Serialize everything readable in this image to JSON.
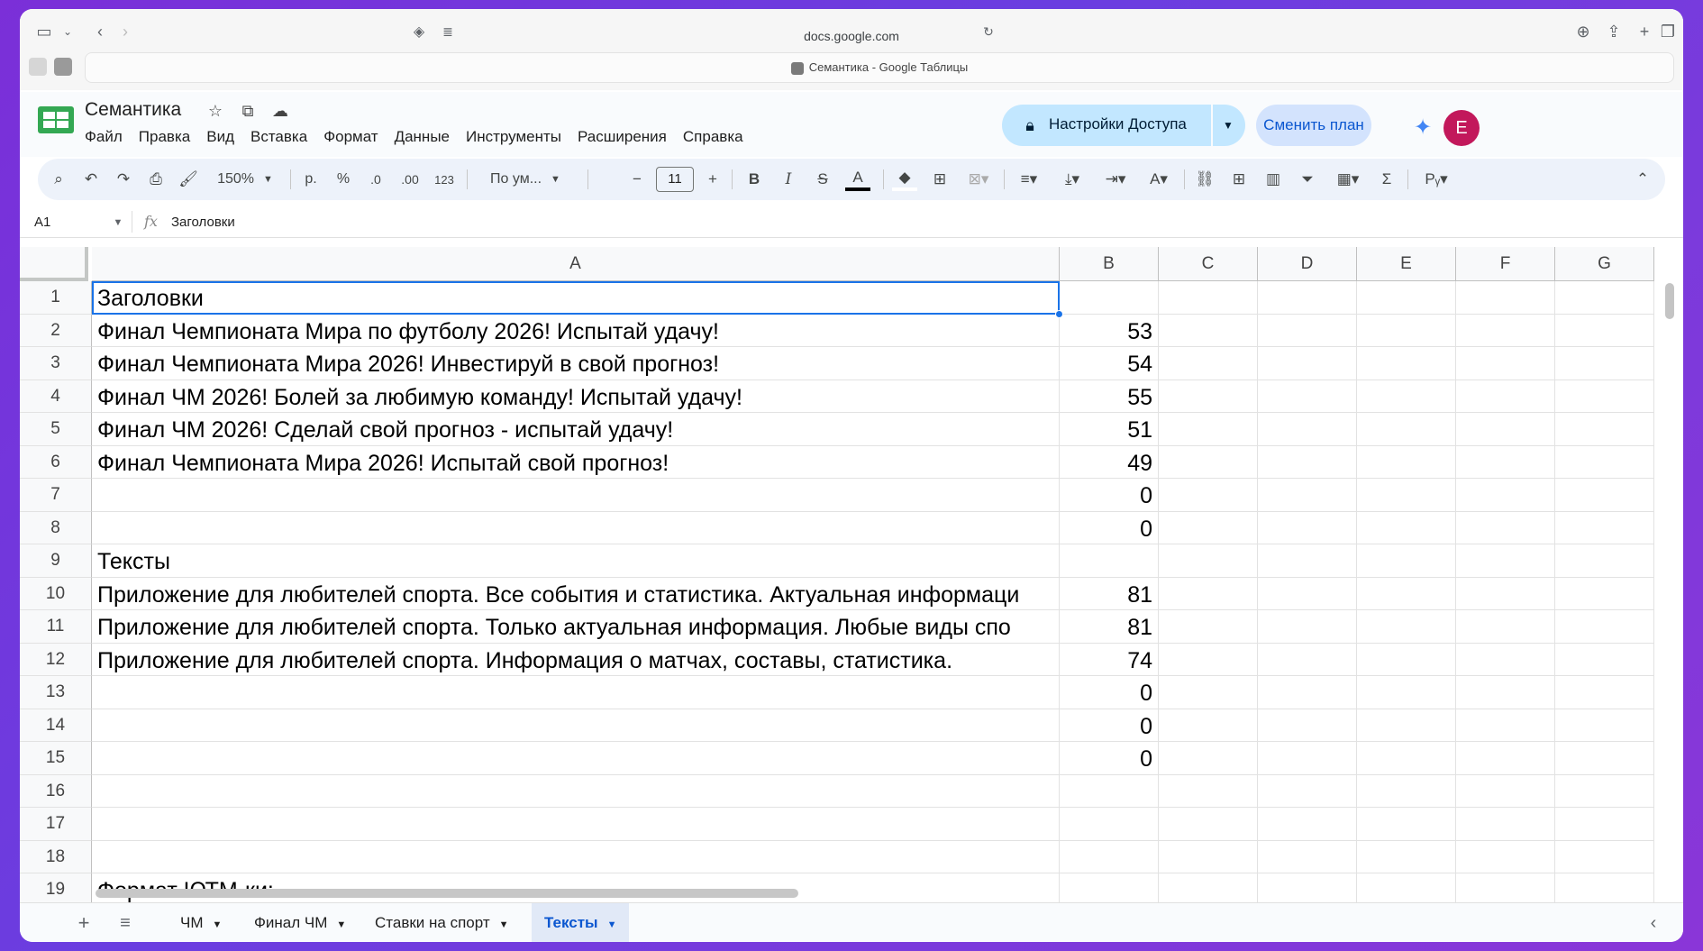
{
  "browser": {
    "url": "docs.google.com",
    "tab_title": "Семантика - Google Таблицы"
  },
  "header": {
    "doc_title": "Семантика",
    "menu": [
      "Файл",
      "Правка",
      "Вид",
      "Вставка",
      "Формат",
      "Данные",
      "Инструменты",
      "Расширения",
      "Справка"
    ],
    "access_button": "Настройки Доступа",
    "plan_button": "Сменить план",
    "avatar_letter": "E"
  },
  "toolbar": {
    "zoom": "150%",
    "currency": "р.",
    "percent": "%",
    "dec_decrease": ".0",
    "dec_increase": ".00",
    "number_format": "123",
    "font": "По ум...",
    "font_size": "11"
  },
  "formula_bar": {
    "cell_ref": "A1",
    "fx": "fx",
    "content": "Заголовки"
  },
  "columns": [
    "A",
    "B",
    "C",
    "D",
    "E",
    "F",
    "G"
  ],
  "rows": [
    {
      "num": "1",
      "a": "Заголовки",
      "b": ""
    },
    {
      "num": "2",
      "a": "Финал Чемпионата Мира по футболу 2026! Испытай удачу!",
      "b": "53"
    },
    {
      "num": "3",
      "a": "Финал Чемпионата Мира 2026! Инвестируй в свой прогноз!",
      "b": "54"
    },
    {
      "num": "4",
      "a": "Финал ЧМ 2026! Болей за любимую команду! Испытай удачу!",
      "b": "55"
    },
    {
      "num": "5",
      "a": "Финал ЧМ 2026! Сделай свой прогноз - испытай удачу!",
      "b": "51"
    },
    {
      "num": "6",
      "a": "Финал Чемпионата Мира 2026! Испытай свой прогноз!",
      "b": "49"
    },
    {
      "num": "7",
      "a": "",
      "b": "0"
    },
    {
      "num": "8",
      "a": "",
      "b": "0"
    },
    {
      "num": "9",
      "a": "Тексты",
      "b": ""
    },
    {
      "num": "10",
      "a": "Приложение для любителей спорта. Все события и статистика. Актуальная информаци",
      "b": "81"
    },
    {
      "num": "11",
      "a": "Приложение для любителей спорта. Только актуальная информация. Любые виды спо",
      "b": "81"
    },
    {
      "num": "12",
      "a": "Приложение для любителей спорта. Информация о матчах, составы, статистика.",
      "b": "74"
    },
    {
      "num": "13",
      "a": "",
      "b": "0"
    },
    {
      "num": "14",
      "a": "",
      "b": "0"
    },
    {
      "num": "15",
      "a": "",
      "b": "0"
    },
    {
      "num": "16",
      "a": "",
      "b": ""
    },
    {
      "num": "17",
      "a": "",
      "b": ""
    },
    {
      "num": "18",
      "a": "",
      "b": ""
    },
    {
      "num": "19",
      "a": "Формат ЮТМ-ки:",
      "b": ""
    }
  ],
  "sheet_tabs": [
    {
      "label": "ЧМ",
      "active": false
    },
    {
      "label": "Финал ЧМ",
      "active": false
    },
    {
      "label": "Ставки на спорт",
      "active": false
    },
    {
      "label": "Тексты",
      "active": true
    }
  ],
  "colors": {
    "accent": "#1a73e8",
    "access_button_bg": "#c2e7ff",
    "plan_button_bg": "#d3e3fd",
    "avatar_bg": "#c2185b",
    "backdrop": "#7b2fd8"
  }
}
